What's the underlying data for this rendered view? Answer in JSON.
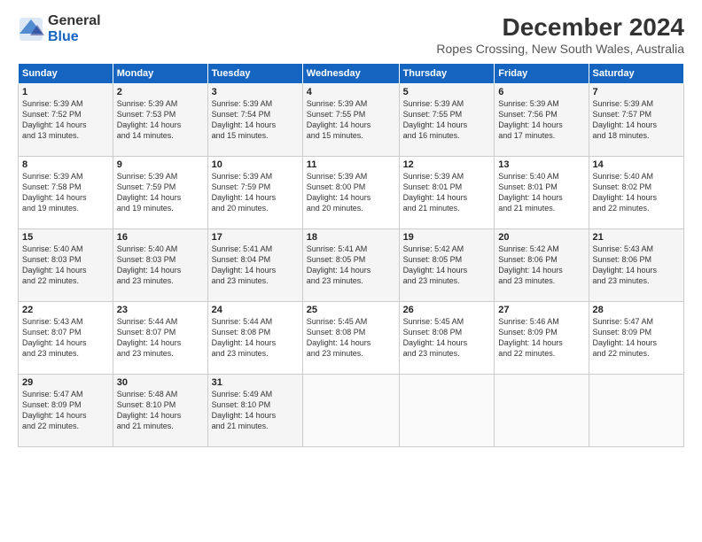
{
  "logo": {
    "general": "General",
    "blue": "Blue"
  },
  "title": "December 2024",
  "subtitle": "Ropes Crossing, New South Wales, Australia",
  "days_header": [
    "Sunday",
    "Monday",
    "Tuesday",
    "Wednesday",
    "Thursday",
    "Friday",
    "Saturday"
  ],
  "weeks": [
    [
      {
        "day": "1",
        "info": "Sunrise: 5:39 AM\nSunset: 7:52 PM\nDaylight: 14 hours\nand 13 minutes."
      },
      {
        "day": "2",
        "info": "Sunrise: 5:39 AM\nSunset: 7:53 PM\nDaylight: 14 hours\nand 14 minutes."
      },
      {
        "day": "3",
        "info": "Sunrise: 5:39 AM\nSunset: 7:54 PM\nDaylight: 14 hours\nand 15 minutes."
      },
      {
        "day": "4",
        "info": "Sunrise: 5:39 AM\nSunset: 7:55 PM\nDaylight: 14 hours\nand 15 minutes."
      },
      {
        "day": "5",
        "info": "Sunrise: 5:39 AM\nSunset: 7:55 PM\nDaylight: 14 hours\nand 16 minutes."
      },
      {
        "day": "6",
        "info": "Sunrise: 5:39 AM\nSunset: 7:56 PM\nDaylight: 14 hours\nand 17 minutes."
      },
      {
        "day": "7",
        "info": "Sunrise: 5:39 AM\nSunset: 7:57 PM\nDaylight: 14 hours\nand 18 minutes."
      }
    ],
    [
      {
        "day": "8",
        "info": "Sunrise: 5:39 AM\nSunset: 7:58 PM\nDaylight: 14 hours\nand 19 minutes."
      },
      {
        "day": "9",
        "info": "Sunrise: 5:39 AM\nSunset: 7:59 PM\nDaylight: 14 hours\nand 19 minutes."
      },
      {
        "day": "10",
        "info": "Sunrise: 5:39 AM\nSunset: 7:59 PM\nDaylight: 14 hours\nand 20 minutes."
      },
      {
        "day": "11",
        "info": "Sunrise: 5:39 AM\nSunset: 8:00 PM\nDaylight: 14 hours\nand 20 minutes."
      },
      {
        "day": "12",
        "info": "Sunrise: 5:39 AM\nSunset: 8:01 PM\nDaylight: 14 hours\nand 21 minutes."
      },
      {
        "day": "13",
        "info": "Sunrise: 5:40 AM\nSunset: 8:01 PM\nDaylight: 14 hours\nand 21 minutes."
      },
      {
        "day": "14",
        "info": "Sunrise: 5:40 AM\nSunset: 8:02 PM\nDaylight: 14 hours\nand 22 minutes."
      }
    ],
    [
      {
        "day": "15",
        "info": "Sunrise: 5:40 AM\nSunset: 8:03 PM\nDaylight: 14 hours\nand 22 minutes."
      },
      {
        "day": "16",
        "info": "Sunrise: 5:40 AM\nSunset: 8:03 PM\nDaylight: 14 hours\nand 23 minutes."
      },
      {
        "day": "17",
        "info": "Sunrise: 5:41 AM\nSunset: 8:04 PM\nDaylight: 14 hours\nand 23 minutes."
      },
      {
        "day": "18",
        "info": "Sunrise: 5:41 AM\nSunset: 8:05 PM\nDaylight: 14 hours\nand 23 minutes."
      },
      {
        "day": "19",
        "info": "Sunrise: 5:42 AM\nSunset: 8:05 PM\nDaylight: 14 hours\nand 23 minutes."
      },
      {
        "day": "20",
        "info": "Sunrise: 5:42 AM\nSunset: 8:06 PM\nDaylight: 14 hours\nand 23 minutes."
      },
      {
        "day": "21",
        "info": "Sunrise: 5:43 AM\nSunset: 8:06 PM\nDaylight: 14 hours\nand 23 minutes."
      }
    ],
    [
      {
        "day": "22",
        "info": "Sunrise: 5:43 AM\nSunset: 8:07 PM\nDaylight: 14 hours\nand 23 minutes."
      },
      {
        "day": "23",
        "info": "Sunrise: 5:44 AM\nSunset: 8:07 PM\nDaylight: 14 hours\nand 23 minutes."
      },
      {
        "day": "24",
        "info": "Sunrise: 5:44 AM\nSunset: 8:08 PM\nDaylight: 14 hours\nand 23 minutes."
      },
      {
        "day": "25",
        "info": "Sunrise: 5:45 AM\nSunset: 8:08 PM\nDaylight: 14 hours\nand 23 minutes."
      },
      {
        "day": "26",
        "info": "Sunrise: 5:45 AM\nSunset: 8:08 PM\nDaylight: 14 hours\nand 23 minutes."
      },
      {
        "day": "27",
        "info": "Sunrise: 5:46 AM\nSunset: 8:09 PM\nDaylight: 14 hours\nand 22 minutes."
      },
      {
        "day": "28",
        "info": "Sunrise: 5:47 AM\nSunset: 8:09 PM\nDaylight: 14 hours\nand 22 minutes."
      }
    ],
    [
      {
        "day": "29",
        "info": "Sunrise: 5:47 AM\nSunset: 8:09 PM\nDaylight: 14 hours\nand 22 minutes."
      },
      {
        "day": "30",
        "info": "Sunrise: 5:48 AM\nSunset: 8:10 PM\nDaylight: 14 hours\nand 21 minutes."
      },
      {
        "day": "31",
        "info": "Sunrise: 5:49 AM\nSunset: 8:10 PM\nDaylight: 14 hours\nand 21 minutes."
      },
      null,
      null,
      null,
      null
    ]
  ]
}
